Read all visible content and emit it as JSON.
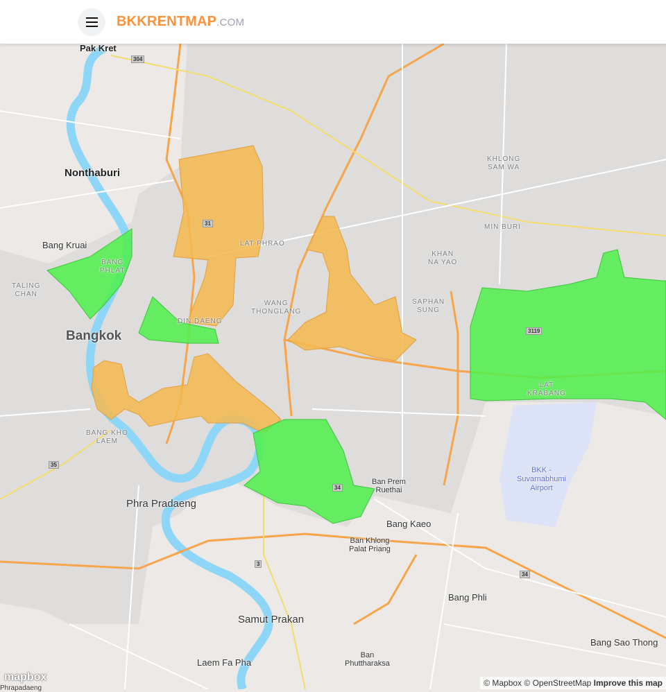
{
  "header": {
    "menu_icon": "hamburger-icon",
    "brand": "BKKRENTMAP",
    "brand_tld": ".COM"
  },
  "colors": {
    "brand": "#fb923c",
    "zone_orange": "#f6b84f",
    "zone_green": "#4ff04a",
    "river": "#8ed6f7",
    "highway": "#f6a54a"
  },
  "labels": {
    "pak_kret": "Pak Kret",
    "nonthaburi": "Nonthaburi",
    "bang_kruai": "Bang Kruai",
    "bangkok": "Bangkok",
    "phra_pradaeng": "Phra Pradaeng",
    "samut_prakan": "Samut Prakan",
    "laem_fa_pha": "Laem Fa Pha",
    "bang_kaeo": "Bang Kaeo",
    "bang_phli": "Bang Phli",
    "bang_sao_thong": "Bang Sao Thong",
    "ban_prem_ruethai": "Ban Prem\nRuethai",
    "ban_khlong": "Ban Khlong\nPalat Priang",
    "ban_phutthaaraksa": "Ban\nPhuttharaksa",
    "phrapadaeng_cut": "Phrapadaeng",
    "khlong_sam_wa": "KHLONG\nSAM WA",
    "min_buri": "MIN BURI",
    "lat_phrao": "LAT PHRAO",
    "khan_na_yao": "KHAN\nNA YAO",
    "bang_phlat": "BANG\nPHLAT",
    "taling_chan": "TALING\nCHAN",
    "din_daeng": "DIN DAENG",
    "wang_thonglang": "WANG\nTHONGLANG",
    "saphan_sung": "SAPHAN\nSUNG",
    "lat_krabang": "LAT\nKRABANG",
    "bang_kho_laem": "BANG KHO\nLAEM",
    "airport": "BKK -\nSuvarnabhumi\nAirport"
  },
  "shields": {
    "r304": "304",
    "r31": "31",
    "r3119": "3119",
    "r34": "34",
    "r35": "35",
    "r3": "3",
    "r34b": "34"
  },
  "attribution": {
    "mapbox": "© Mapbox",
    "osm": "© OpenStreetMap",
    "improve": "Improve this map",
    "logo": "mapbox"
  }
}
